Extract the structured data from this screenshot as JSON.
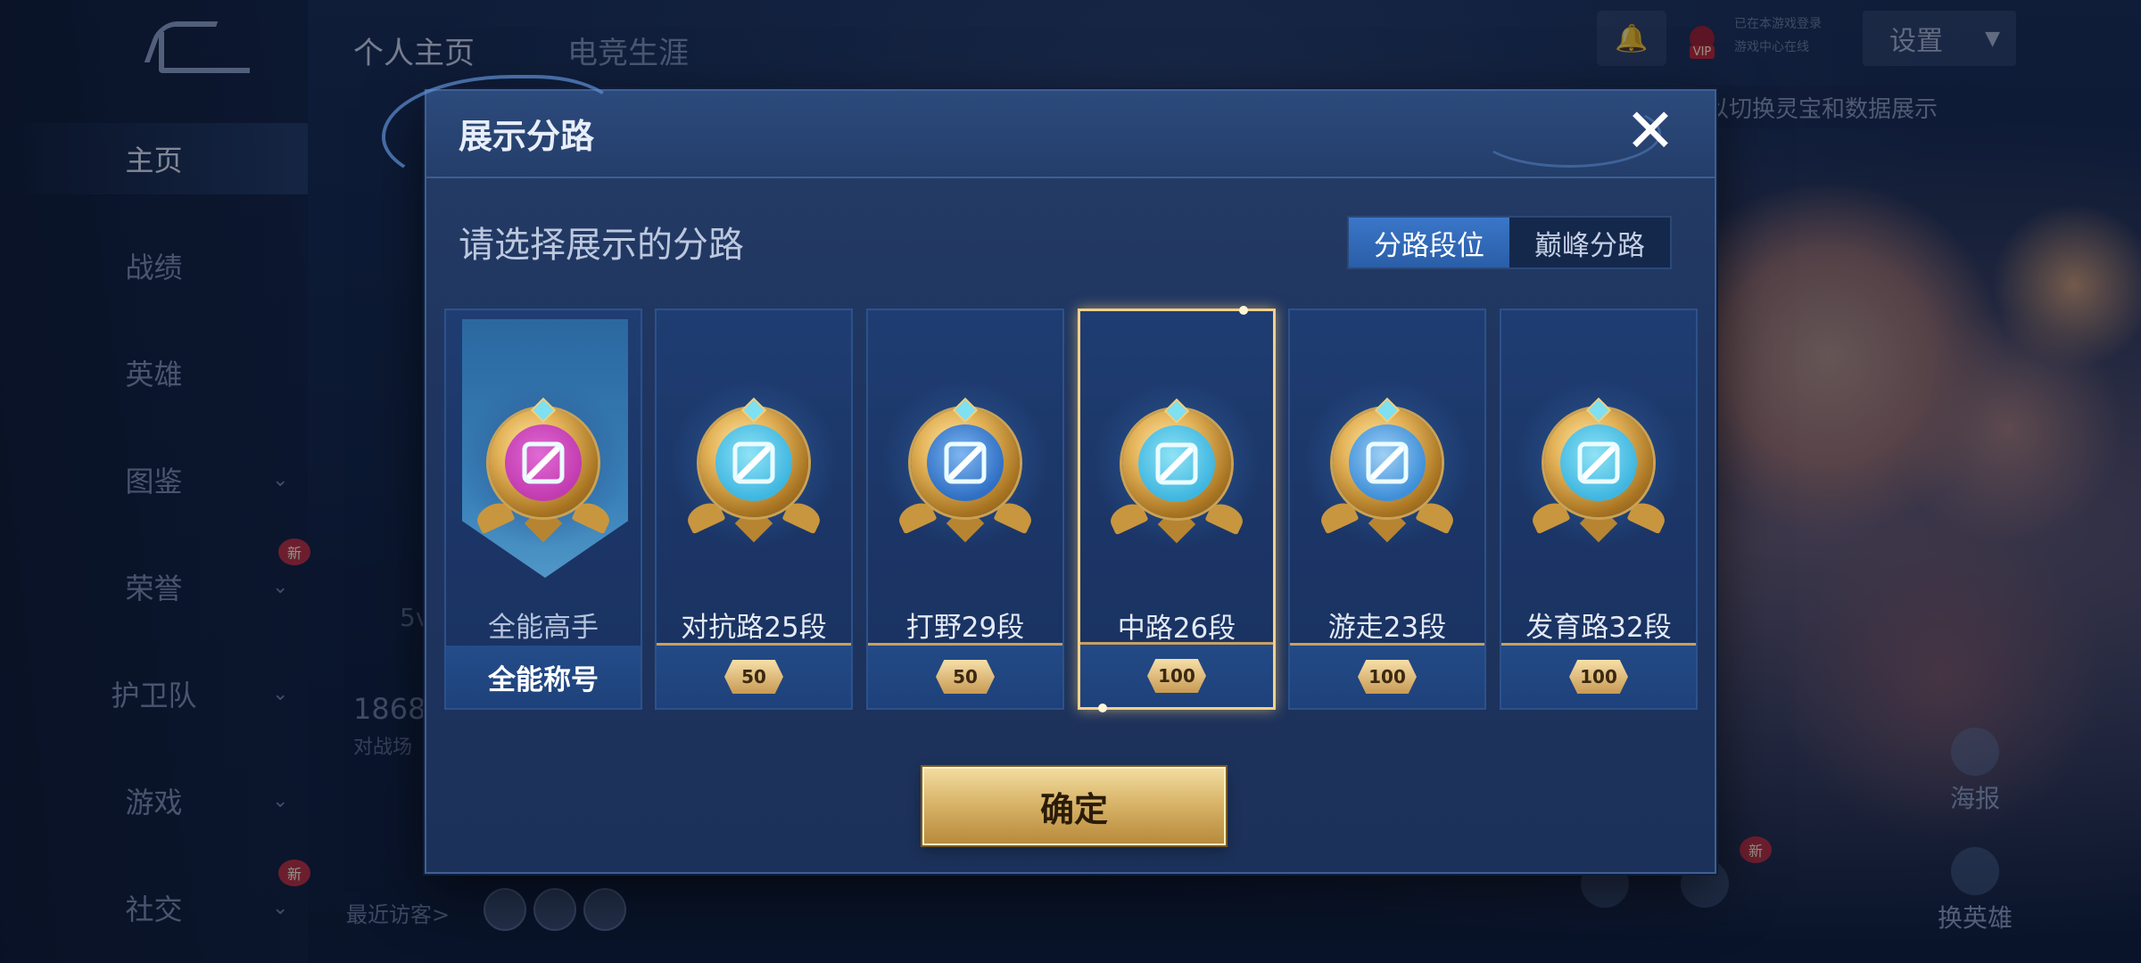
{
  "colors": {
    "accent_gold": "#f0d08a",
    "segment_active": "#3a76c8",
    "modal_bg": "#1f3560"
  },
  "top_tabs": [
    "个人主页",
    "电竞生涯"
  ],
  "sidebar": {
    "items": [
      {
        "label": "主页",
        "active": true,
        "chevron": false,
        "new": false
      },
      {
        "label": "战绩",
        "active": false,
        "chevron": false,
        "new": false
      },
      {
        "label": "英雄",
        "active": false,
        "chevron": false,
        "new": false
      },
      {
        "label": "图鉴",
        "active": false,
        "chevron": true,
        "new": false
      },
      {
        "label": "荣誉",
        "active": false,
        "chevron": true,
        "new": true
      },
      {
        "label": "护卫队",
        "active": false,
        "chevron": true,
        "new": false
      },
      {
        "label": "游戏",
        "active": false,
        "chevron": true,
        "new": false
      },
      {
        "label": "社交",
        "active": false,
        "chevron": true,
        "new": true
      }
    ],
    "new_badge": "新"
  },
  "topbar": {
    "settings_label": "设置",
    "vip_label": "VIP",
    "status_line1": "已在本游戏登录",
    "status_line2": "游戏中心在线",
    "hint": "以切换灵宝和数据展示"
  },
  "background": {
    "profile_stat": "1868",
    "profile_stat_sub": "对战场",
    "left_peek": "5v",
    "recent_visitors": "最近访客>",
    "poster": "海报",
    "switch_hero": "换英雄",
    "new_badge": "新"
  },
  "modal": {
    "title": "展示分路",
    "prompt": "请选择展示的分路",
    "segments": [
      {
        "label": "分路段位",
        "active": true
      },
      {
        "label": "巅峰分路",
        "active": false
      }
    ],
    "cards": [
      {
        "label": "全能高手",
        "footer": "全能称号",
        "type": "title",
        "icon": "all-round-icon",
        "color": "#c23bb0",
        "inner": "#e06ad4",
        "selected": false
      },
      {
        "label": "对抗路25段",
        "footer": "50",
        "type": "stars",
        "icon": "clash-lane-icon",
        "color": "#3fb6e0",
        "inner": "#8fe3f5",
        "selected": false
      },
      {
        "label": "打野29段",
        "footer": "50",
        "type": "stars",
        "icon": "jungle-icon",
        "color": "#2f6fc4",
        "inner": "#7fb6f0",
        "selected": false
      },
      {
        "label": "中路26段",
        "footer": "100",
        "type": "stars",
        "icon": "mid-lane-icon",
        "color": "#3fb6e0",
        "inner": "#8fe3f5",
        "selected": true
      },
      {
        "label": "游走23段",
        "footer": "100",
        "type": "stars",
        "icon": "roam-icon",
        "color": "#3f8fd8",
        "inner": "#9fd0f5",
        "selected": false
      },
      {
        "label": "发育路32段",
        "footer": "100",
        "type": "stars",
        "icon": "farm-lane-icon",
        "color": "#3fb6e0",
        "inner": "#8fe3f5",
        "selected": false
      }
    ],
    "confirm_label": "确定"
  }
}
